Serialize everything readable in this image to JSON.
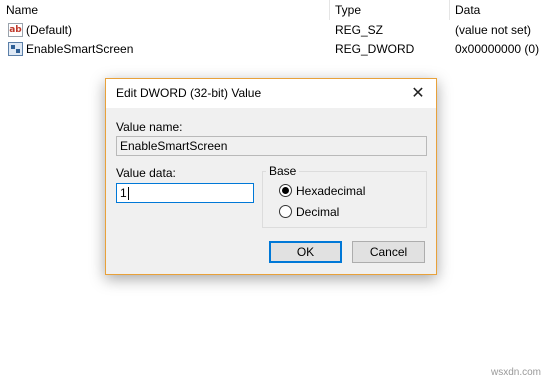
{
  "columns": {
    "name": "Name",
    "type": "Type",
    "data": "Data"
  },
  "rows": [
    {
      "icon": "string-value-icon",
      "icon_text": "ab",
      "name": "(Default)",
      "type": "REG_SZ",
      "data": "(value not set)"
    },
    {
      "icon": "binary-value-icon",
      "name": "EnableSmartScreen",
      "type": "REG_DWORD",
      "data": "0x00000000 (0)"
    }
  ],
  "dialog": {
    "title": "Edit DWORD (32-bit) Value",
    "close_glyph": "✕",
    "value_name_label": "Value name:",
    "value_name": "EnableSmartScreen",
    "value_data_label": "Value data:",
    "value_data": "1",
    "base_label": "Base",
    "base_options": [
      {
        "label": "Hexadecimal",
        "selected": true
      },
      {
        "label": "Decimal",
        "selected": false
      }
    ],
    "ok_label": "OK",
    "cancel_label": "Cancel",
    "accent_color": "#0078d7",
    "border_color": "#e8a13a"
  },
  "watermark": "wsxdn.com"
}
